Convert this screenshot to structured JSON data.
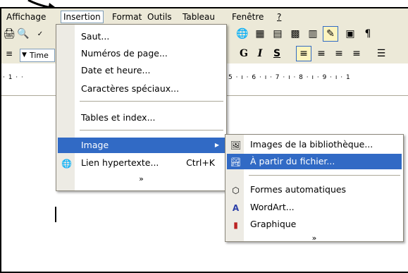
{
  "menubar": {
    "items": [
      {
        "label": "Affichage"
      },
      {
        "label": "Insertion"
      },
      {
        "label": "Format"
      },
      {
        "label": "Outils"
      },
      {
        "label": "Tableau"
      },
      {
        "label": "Fenêtre"
      },
      {
        "label": "?"
      }
    ]
  },
  "formatting": {
    "font_name": "Time",
    "bold": "G",
    "italic": "I",
    "underline": "S"
  },
  "ruler": {
    "left_marks": "· 1 · ·",
    "right_marks": "5 · ı · 6 · ı · 7 · ı · 8 · ı · 9 · ı · 1"
  },
  "insertion_menu": {
    "items": [
      {
        "label": "Saut..."
      },
      {
        "label": "Numéros de page..."
      },
      {
        "label": "Date et heure..."
      },
      {
        "label": "Caractères spéciaux..."
      },
      {
        "label": "Tables et index..."
      },
      {
        "label": "Image",
        "has_submenu": true
      },
      {
        "label": "Lien hypertexte...",
        "shortcut": "Ctrl+K",
        "icon": "hyperlink-globe-icon"
      }
    ],
    "expand_more": "»"
  },
  "image_submenu": {
    "items": [
      {
        "label": "Images de la bibliothèque...",
        "icon": "clipart-icon"
      },
      {
        "label": "À partir du fichier...",
        "icon": "picture-from-file-icon"
      },
      {
        "label": "Formes automatiques",
        "icon": "autoshapes-icon"
      },
      {
        "label": "WordArt...",
        "icon": "wordart-icon"
      },
      {
        "label": "Graphique",
        "icon": "chart-icon"
      }
    ],
    "expand_more": "»"
  },
  "colors": {
    "highlight": "#316ac5",
    "menu_bg": "#ffffff",
    "toolbar_bg": "#ece9d8"
  }
}
